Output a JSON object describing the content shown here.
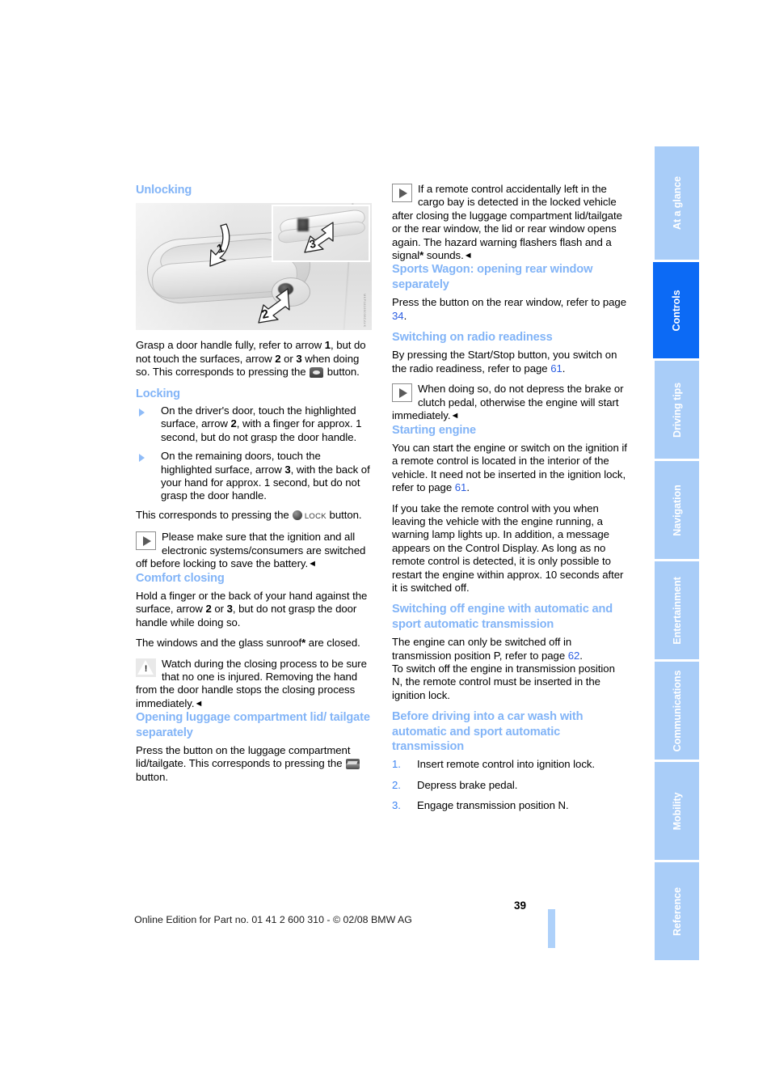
{
  "document": {
    "page_number": "39",
    "footer_text": "Online Edition for Part no. 01 41 2 600 310 - © 02/08 BMW AG"
  },
  "sidebar": {
    "tabs": [
      {
        "label": "At a glance",
        "active": false
      },
      {
        "label": "Controls",
        "active": true
      },
      {
        "label": "Driving tips",
        "active": false
      },
      {
        "label": "Navigation",
        "active": false
      },
      {
        "label": "Entertainment",
        "active": false
      },
      {
        "label": "Communications",
        "active": false
      },
      {
        "label": "Mobility",
        "active": false
      },
      {
        "label": "Reference",
        "active": false
      }
    ]
  },
  "left_column": {
    "unlocking": {
      "heading": "Unlocking",
      "figure": {
        "callout_1": "1",
        "callout_2": "2",
        "callout_3": "3",
        "code": "MKP18169038CAVK"
      },
      "para_a": "Grasp a door handle fully, refer to arrow ",
      "para_b": ", but do not touch the surfaces, arrow ",
      "para_c": " or ",
      "para_d": " when doing so. This corresponds to pressing the ",
      "para_e": " button.",
      "bold_1": "1",
      "bold_2": "2",
      "bold_3": "3"
    },
    "locking": {
      "heading": "Locking",
      "bullet_1_a": "On the driver's door, touch the highlighted surface, arrow ",
      "bullet_1_bold": "2",
      "bullet_1_b": ", with a finger for approx. 1 second, but do not grasp the door handle.",
      "bullet_2_a": "On the remaining doors, touch the highlighted surface, arrow ",
      "bullet_2_bold": "3",
      "bullet_2_b": ", with the back of your hand for approx. 1 second, but do not grasp the door handle.",
      "corresponds_a": "This corresponds to pressing the ",
      "lock_word": "LOCK",
      "corresponds_b": " button.",
      "note": "Please make sure that the ignition and all electronic systems/consumers are switched off before locking to save the battery."
    },
    "comfort_closing": {
      "heading": "Comfort closing",
      "para_1_a": "Hold a finger or the back of your hand against the surface, arrow ",
      "para_1_bold_a": "2",
      "para_1_mid": " or ",
      "para_1_bold_b": "3",
      "para_1_b": ", but do not grasp the door handle while doing so.",
      "para_2_a": "The windows and the glass sunroof",
      "para_2_star": "*",
      "para_2_b": " are closed.",
      "warning": "Watch during the closing process to be sure that no one is injured. Removing the hand from the door handle stops the closing process immediately."
    },
    "opening_luggage": {
      "heading": "Opening luggage compartment lid/ tailgate separately",
      "para_a": "Press the button on the luggage compartment lid/tailgate. This corresponds to pressing the ",
      "para_b": " button."
    }
  },
  "right_column": {
    "cargo_note": {
      "text_a": "If a remote control accidentally left in the cargo bay is detected in the locked vehicle after closing the luggage compartment lid/tailgate or the rear window, the lid or rear window opens again. The hazard warning flashers flash and a signal",
      "star": "*",
      "text_b": " sounds."
    },
    "sports_wagon": {
      "heading": "Sports Wagon: opening rear window separately",
      "para_a": "Press the button on the rear window, refer to page ",
      "page_ref": "34",
      "para_b": "."
    },
    "radio_readiness": {
      "heading": "Switching on radio readiness",
      "para_a": "By pressing the Start/Stop button, you switch on the radio readiness, refer to page ",
      "page_ref": "61",
      "para_b": ".",
      "note": "When doing so, do not depress the brake or clutch pedal, otherwise the engine will start immediately."
    },
    "starting_engine": {
      "heading": "Starting engine",
      "para_1_a": "You can start the engine or switch on the ignition if a remote control is located in the interior of the vehicle. It need not be inserted in the ignition lock, refer to page ",
      "para_1_ref": "61",
      "para_1_b": ".",
      "para_2": "If you take the remote control with you when leaving the vehicle with the engine running, a warning lamp lights up. In addition, a message appears on the Control Display. As long as no remote control is detected, it is only possible to restart the engine within approx. 10 seconds after it is switched off."
    },
    "switching_off": {
      "heading": "Switching off engine with automatic and sport automatic transmission",
      "para_a": "The engine can only be switched off in transmission position P, refer to page ",
      "page_ref": "62",
      "para_b": ".",
      "para_c": "To switch off the engine in transmission position N, the remote control must be inserted in the ignition lock."
    },
    "car_wash": {
      "heading": "Before driving into a car wash with automatic and sport automatic transmission",
      "steps": [
        {
          "num": "1.",
          "text": "Insert remote control into ignition lock."
        },
        {
          "num": "2.",
          "text": "Depress brake pedal."
        },
        {
          "num": "3.",
          "text": "Engage transmission position N."
        }
      ]
    }
  },
  "colors": {
    "heading_blue": "#82b4f7",
    "tab_inactive": "#a9cdf8",
    "tab_active": "#0c6af5",
    "page_ref_blue": "#2b5ee2",
    "step_num_blue": "#3d84f2"
  }
}
